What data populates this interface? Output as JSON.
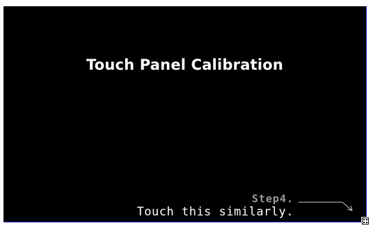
{
  "calibration": {
    "title": "Touch Panel Calibration",
    "step_label": "Step4.",
    "instruction": "Touch this similarly.",
    "target_icon": "crosshair-target-icon",
    "arrow_icon": "pointer-arrow-icon"
  },
  "colors": {
    "background": "#000000",
    "title": "#ffffff",
    "step": "#9a9a9a",
    "instruction": "#ffffff",
    "frame_border": "#2a2ad0"
  }
}
